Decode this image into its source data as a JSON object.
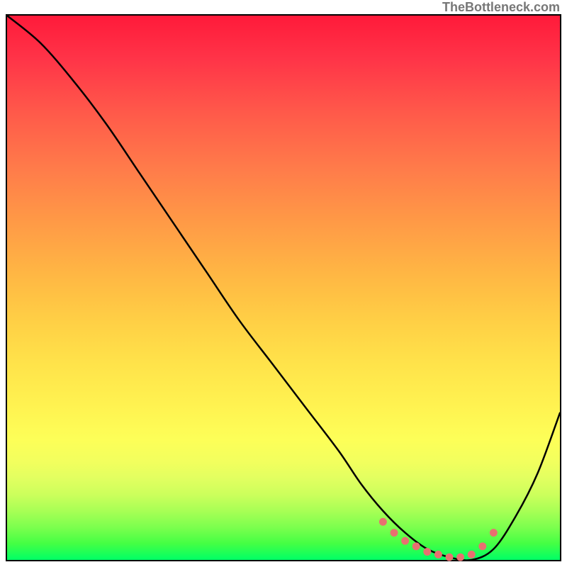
{
  "watermark": "TheBottleneck.com",
  "chart_data": {
    "type": "line",
    "title": "",
    "xlabel": "",
    "ylabel": "",
    "xlim": [
      0,
      100
    ],
    "ylim": [
      0,
      100
    ],
    "grid": false,
    "series": [
      {
        "name": "bottleneck-curve",
        "color": "#000000",
        "x": [
          0,
          6,
          12,
          18,
          24,
          30,
          36,
          42,
          48,
          54,
          60,
          64,
          68,
          72,
          76,
          80,
          84,
          88,
          92,
          96,
          100
        ],
        "y": [
          100,
          95,
          88,
          80,
          71,
          62,
          53,
          44,
          36,
          28,
          20,
          14,
          9,
          5,
          2,
          0.5,
          0,
          2,
          8,
          16,
          27
        ]
      }
    ],
    "optimal_band": {
      "name": "optimal-range-markers",
      "color": "#e87070",
      "x": [
        68,
        70,
        72,
        74,
        76,
        78,
        80,
        82,
        84,
        86,
        88
      ],
      "y": [
        7,
        5,
        3.5,
        2.5,
        1.5,
        1,
        0.5,
        0.5,
        1,
        2.5,
        5
      ]
    },
    "background_gradient": {
      "top": "#ff1a3a",
      "mid": "#fff351",
      "bottom": "#00ff66"
    }
  }
}
